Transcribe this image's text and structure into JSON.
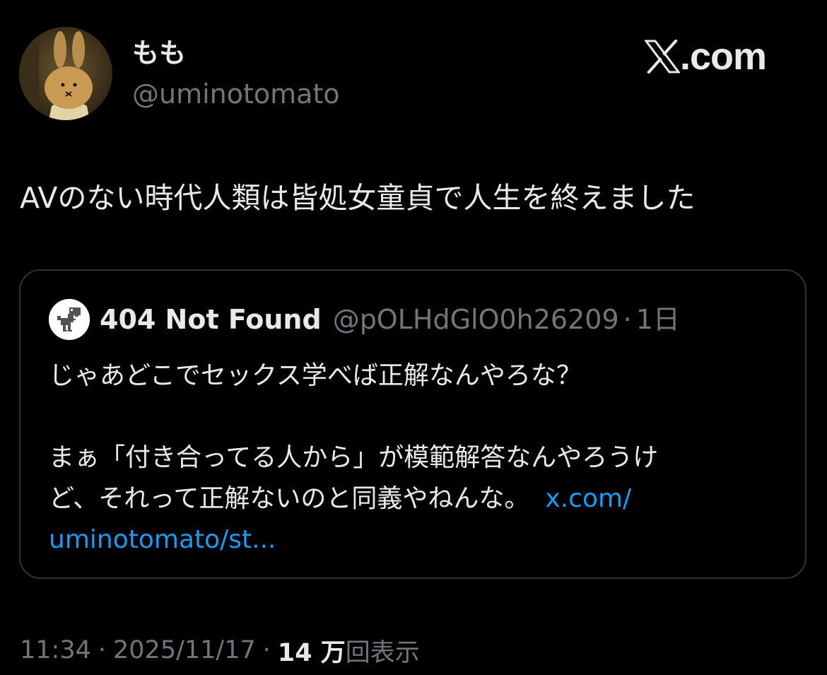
{
  "tweet": {
    "author": {
      "display_name": "もも",
      "handle": "@uminotomato",
      "avatar_icon": "bunny-avatar-icon"
    },
    "text": "AVのない時代人類は皆処女童貞で人生を終えました",
    "quote": {
      "author": {
        "display_name": "404 Not Found",
        "handle": "@pOLHdGlO0h26209",
        "separator": "·",
        "time": "1日",
        "avatar_icon": "dinosaur-avatar-icon"
      },
      "lines": [
        "じゃあどこでセックス学べば正解なんやろな？",
        "まぁ「付き合ってる人から」が模範解答なんやろうけ",
        "ど、それって正解ないのと同義やねんな。"
      ],
      "link_part1": "x.com/",
      "link_part2": "uminotomato/st..."
    },
    "meta": {
      "time": "11:34",
      "separator": "·",
      "date": "2025/11/17",
      "views_count": "14 万",
      "views_label": "回表示"
    }
  },
  "brand": {
    "text": ".com",
    "icon": "x-logo-icon"
  },
  "colors": {
    "background": "#000000",
    "text_primary": "#e7e9ea",
    "text_secondary": "#71767b",
    "link": "#1d9bf0",
    "border": "#2f3336"
  }
}
